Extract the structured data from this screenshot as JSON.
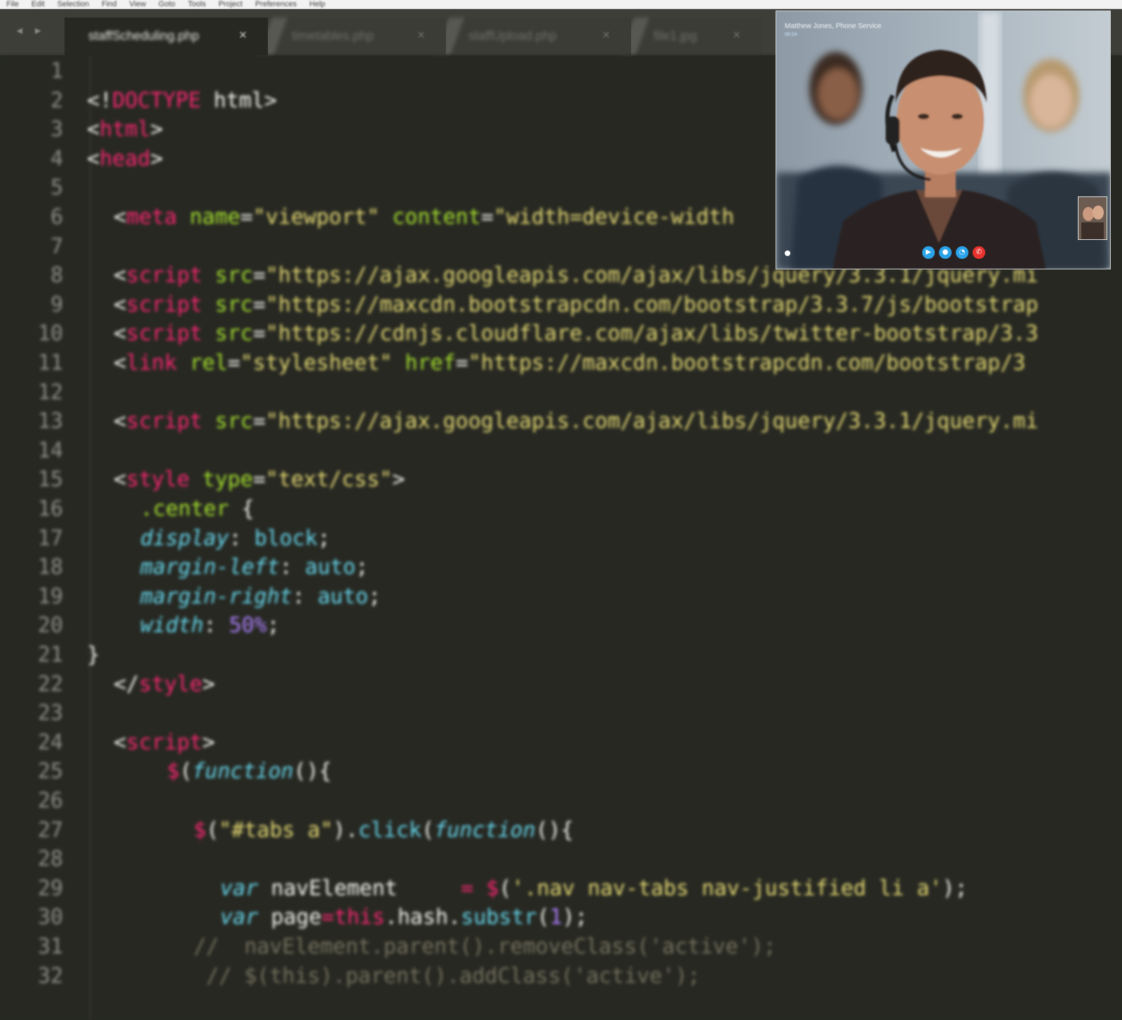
{
  "menu_bar": [
    "File",
    "Edit",
    "Selection",
    "Find",
    "View",
    "Goto",
    "Tools",
    "Project",
    "Preferences",
    "Help"
  ],
  "tab_bar": {
    "nav_arrows": "◂ ▸",
    "close_glyph": "×",
    "tabs": [
      {
        "label": "staffScheduling.php",
        "active": true
      },
      {
        "label": "timetables.php",
        "active": false
      },
      {
        "label": "staffUpload.php",
        "active": false
      },
      {
        "label": "file1.jpg",
        "active": false
      }
    ]
  },
  "colors": {
    "background": "#272822",
    "tag": "#f92672",
    "attr": "#a6e22e",
    "string": "#e6db74",
    "property": "#66d9ef",
    "number": "#ae81ff",
    "comment": "#75715e",
    "plain": "#f8f8f2"
  },
  "editor": {
    "lines": [
      {
        "n": "1",
        "indent": 0,
        "tokens": []
      },
      {
        "n": "2",
        "indent": 0,
        "tokens": [
          {
            "t": "<!",
            "c": "plain"
          },
          {
            "t": "DOCTYPE",
            "c": "tag"
          },
          {
            "t": " html>",
            "c": "plain"
          }
        ]
      },
      {
        "n": "3",
        "indent": 0,
        "tokens": [
          {
            "t": "<",
            "c": "plain"
          },
          {
            "t": "html",
            "c": "tag"
          },
          {
            "t": ">",
            "c": "plain"
          }
        ]
      },
      {
        "n": "4",
        "indent": 0,
        "tokens": [
          {
            "t": "<",
            "c": "plain"
          },
          {
            "t": "head",
            "c": "tag"
          },
          {
            "t": ">",
            "c": "plain"
          }
        ]
      },
      {
        "n": "5",
        "indent": 0,
        "tokens": []
      },
      {
        "n": "6",
        "indent": 1,
        "tokens": [
          {
            "t": "<",
            "c": "plain"
          },
          {
            "t": "meta",
            "c": "tag"
          },
          {
            "t": " ",
            "c": "plain"
          },
          {
            "t": "name",
            "c": "attr"
          },
          {
            "t": "=",
            "c": "plain"
          },
          {
            "t": "\"viewport\"",
            "c": "string"
          },
          {
            "t": " ",
            "c": "plain"
          },
          {
            "t": "content",
            "c": "attr"
          },
          {
            "t": "=",
            "c": "plain"
          },
          {
            "t": "\"width=device-width",
            "c": "string"
          }
        ]
      },
      {
        "n": "7",
        "indent": 0,
        "tokens": []
      },
      {
        "n": "8",
        "indent": 1,
        "tokens": [
          {
            "t": "<",
            "c": "plain"
          },
          {
            "t": "script",
            "c": "tag"
          },
          {
            "t": " ",
            "c": "plain"
          },
          {
            "t": "src",
            "c": "attr"
          },
          {
            "t": "=",
            "c": "plain"
          },
          {
            "t": "\"https://ajax.googleapis.com/ajax/libs/jquery/3.3.1/jquery.mi",
            "c": "string"
          }
        ]
      },
      {
        "n": "9",
        "indent": 1,
        "tokens": [
          {
            "t": "<",
            "c": "plain"
          },
          {
            "t": "script",
            "c": "tag"
          },
          {
            "t": " ",
            "c": "plain"
          },
          {
            "t": "src",
            "c": "attr"
          },
          {
            "t": "=",
            "c": "plain"
          },
          {
            "t": "\"https://maxcdn.bootstrapcdn.com/bootstrap/3.3.7/js/bootstrap",
            "c": "string"
          }
        ]
      },
      {
        "n": "10",
        "indent": 1,
        "tokens": [
          {
            "t": "<",
            "c": "plain"
          },
          {
            "t": "script",
            "c": "tag"
          },
          {
            "t": " ",
            "c": "plain"
          },
          {
            "t": "src",
            "c": "attr"
          },
          {
            "t": "=",
            "c": "plain"
          },
          {
            "t": "\"https://cdnjs.cloudflare.com/ajax/libs/twitter-bootstrap/3.3",
            "c": "string"
          }
        ]
      },
      {
        "n": "11",
        "indent": 1,
        "tokens": [
          {
            "t": "<",
            "c": "plain"
          },
          {
            "t": "link",
            "c": "tag"
          },
          {
            "t": " ",
            "c": "plain"
          },
          {
            "t": "rel",
            "c": "attr"
          },
          {
            "t": "=",
            "c": "plain"
          },
          {
            "t": "\"stylesheet\"",
            "c": "string"
          },
          {
            "t": " ",
            "c": "plain"
          },
          {
            "t": "href",
            "c": "attr"
          },
          {
            "t": "=",
            "c": "plain"
          },
          {
            "t": "\"https://maxcdn.bootstrapcdn.com/bootstrap/3",
            "c": "string"
          }
        ]
      },
      {
        "n": "12",
        "indent": 0,
        "tokens": []
      },
      {
        "n": "13",
        "indent": 1,
        "tokens": [
          {
            "t": "<",
            "c": "plain"
          },
          {
            "t": "script",
            "c": "tag"
          },
          {
            "t": " ",
            "c": "plain"
          },
          {
            "t": "src",
            "c": "attr"
          },
          {
            "t": "=",
            "c": "plain"
          },
          {
            "t": "\"https://ajax.googleapis.com/ajax/libs/jquery/3.3.1/jquery.mi",
            "c": "string"
          }
        ]
      },
      {
        "n": "14",
        "indent": 0,
        "tokens": []
      },
      {
        "n": "15",
        "indent": 1,
        "tokens": [
          {
            "t": "<",
            "c": "plain"
          },
          {
            "t": "style",
            "c": "tag"
          },
          {
            "t": " ",
            "c": "plain"
          },
          {
            "t": "type",
            "c": "attr"
          },
          {
            "t": "=",
            "c": "plain"
          },
          {
            "t": "\"text/css\"",
            "c": "string"
          },
          {
            "t": ">",
            "c": "plain"
          }
        ]
      },
      {
        "n": "16",
        "indent": 2,
        "tokens": [
          {
            "t": ".center",
            "c": "attr"
          },
          {
            "t": " {",
            "c": "plain"
          }
        ]
      },
      {
        "n": "17",
        "indent": 2,
        "tokens": [
          {
            "t": "display",
            "c": "property"
          },
          {
            "t": ": ",
            "c": "plain"
          },
          {
            "t": "block",
            "c": "property"
          },
          {
            "t": ";",
            "c": "plain"
          }
        ]
      },
      {
        "n": "18",
        "indent": 2,
        "tokens": [
          {
            "t": "margin-left",
            "c": "property"
          },
          {
            "t": ": ",
            "c": "plain"
          },
          {
            "t": "auto",
            "c": "property"
          },
          {
            "t": ";",
            "c": "plain"
          }
        ]
      },
      {
        "n": "19",
        "indent": 2,
        "tokens": [
          {
            "t": "margin-right",
            "c": "property"
          },
          {
            "t": ": ",
            "c": "plain"
          },
          {
            "t": "auto",
            "c": "property"
          },
          {
            "t": ";",
            "c": "plain"
          }
        ]
      },
      {
        "n": "20",
        "indent": 2,
        "tokens": [
          {
            "t": "width",
            "c": "property"
          },
          {
            "t": ": ",
            "c": "plain"
          },
          {
            "t": "50%",
            "c": "number"
          },
          {
            "t": ";",
            "c": "plain"
          }
        ]
      },
      {
        "n": "21",
        "indent": 0,
        "tokens": [
          {
            "t": "}",
            "c": "plain"
          }
        ]
      },
      {
        "n": "22",
        "indent": 1,
        "tokens": [
          {
            "t": "</",
            "c": "plain"
          },
          {
            "t": "style",
            "c": "tag"
          },
          {
            "t": ">",
            "c": "plain"
          }
        ]
      },
      {
        "n": "23",
        "indent": 0,
        "tokens": []
      },
      {
        "n": "24",
        "indent": 1,
        "tokens": [
          {
            "t": "<",
            "c": "plain"
          },
          {
            "t": "script",
            "c": "tag"
          },
          {
            "t": ">",
            "c": "plain"
          }
        ]
      },
      {
        "n": "25",
        "indent": 3,
        "tokens": [
          {
            "t": "$",
            "c": "tag"
          },
          {
            "t": "(",
            "c": "plain"
          },
          {
            "t": "function",
            "c": "property"
          },
          {
            "t": "(){",
            "c": "plain"
          }
        ]
      },
      {
        "n": "26",
        "indent": 0,
        "tokens": []
      },
      {
        "n": "27",
        "indent": 4,
        "tokens": [
          {
            "t": "$",
            "c": "tag"
          },
          {
            "t": "(",
            "c": "plain"
          },
          {
            "t": "\"#tabs a\"",
            "c": "string"
          },
          {
            "t": ").",
            "c": "plain"
          },
          {
            "t": "click",
            "c": "property"
          },
          {
            "t": "(",
            "c": "plain"
          },
          {
            "t": "function",
            "c": "property"
          },
          {
            "t": "(){",
            "c": "plain"
          }
        ]
      },
      {
        "n": "28",
        "indent": 0,
        "tokens": []
      },
      {
        "n": "29",
        "indent": 5,
        "tokens": [
          {
            "t": "var",
            "c": "property"
          },
          {
            "t": " navElement     ",
            "c": "plain"
          },
          {
            "t": "= ",
            "c": "tag"
          },
          {
            "t": "$",
            "c": "tag"
          },
          {
            "t": "(",
            "c": "plain"
          },
          {
            "t": "'.nav nav-tabs nav-justified li a'",
            "c": "string"
          },
          {
            "t": ");",
            "c": "plain"
          }
        ]
      },
      {
        "n": "30",
        "indent": 5,
        "tokens": [
          {
            "t": "var",
            "c": "property"
          },
          {
            "t": " page",
            "c": "plain"
          },
          {
            "t": "=",
            "c": "tag"
          },
          {
            "t": "this",
            "c": "tag"
          },
          {
            "t": ".hash.",
            "c": "plain"
          },
          {
            "t": "substr",
            "c": "property"
          },
          {
            "t": "(",
            "c": "plain"
          },
          {
            "t": "1",
            "c": "number"
          },
          {
            "t": ");",
            "c": "plain"
          }
        ]
      },
      {
        "n": "31",
        "indent": 4,
        "tokens": [
          {
            "t": "//  navElement.parent().removeClass('active');",
            "c": "comment"
          }
        ]
      },
      {
        "n": "32",
        "indent": 4,
        "tokens": [
          {
            "t": " // $(this).parent().addClass('active');",
            "c": "comment"
          }
        ]
      }
    ]
  },
  "video_call": {
    "caller_name": "Matthew Jones, Phone Service",
    "call_status": "00:24",
    "controls": [
      {
        "icon": "video-camera-icon",
        "glyph": "▶",
        "color": "#2aa3e8"
      },
      {
        "icon": "microphone-icon",
        "glyph": "●",
        "color": "#2aa3e8"
      },
      {
        "icon": "chat-icon",
        "glyph": "◔",
        "color": "#2aa3e8"
      },
      {
        "icon": "hang-up-icon",
        "glyph": "✆",
        "color": "#e8322e"
      }
    ]
  }
}
